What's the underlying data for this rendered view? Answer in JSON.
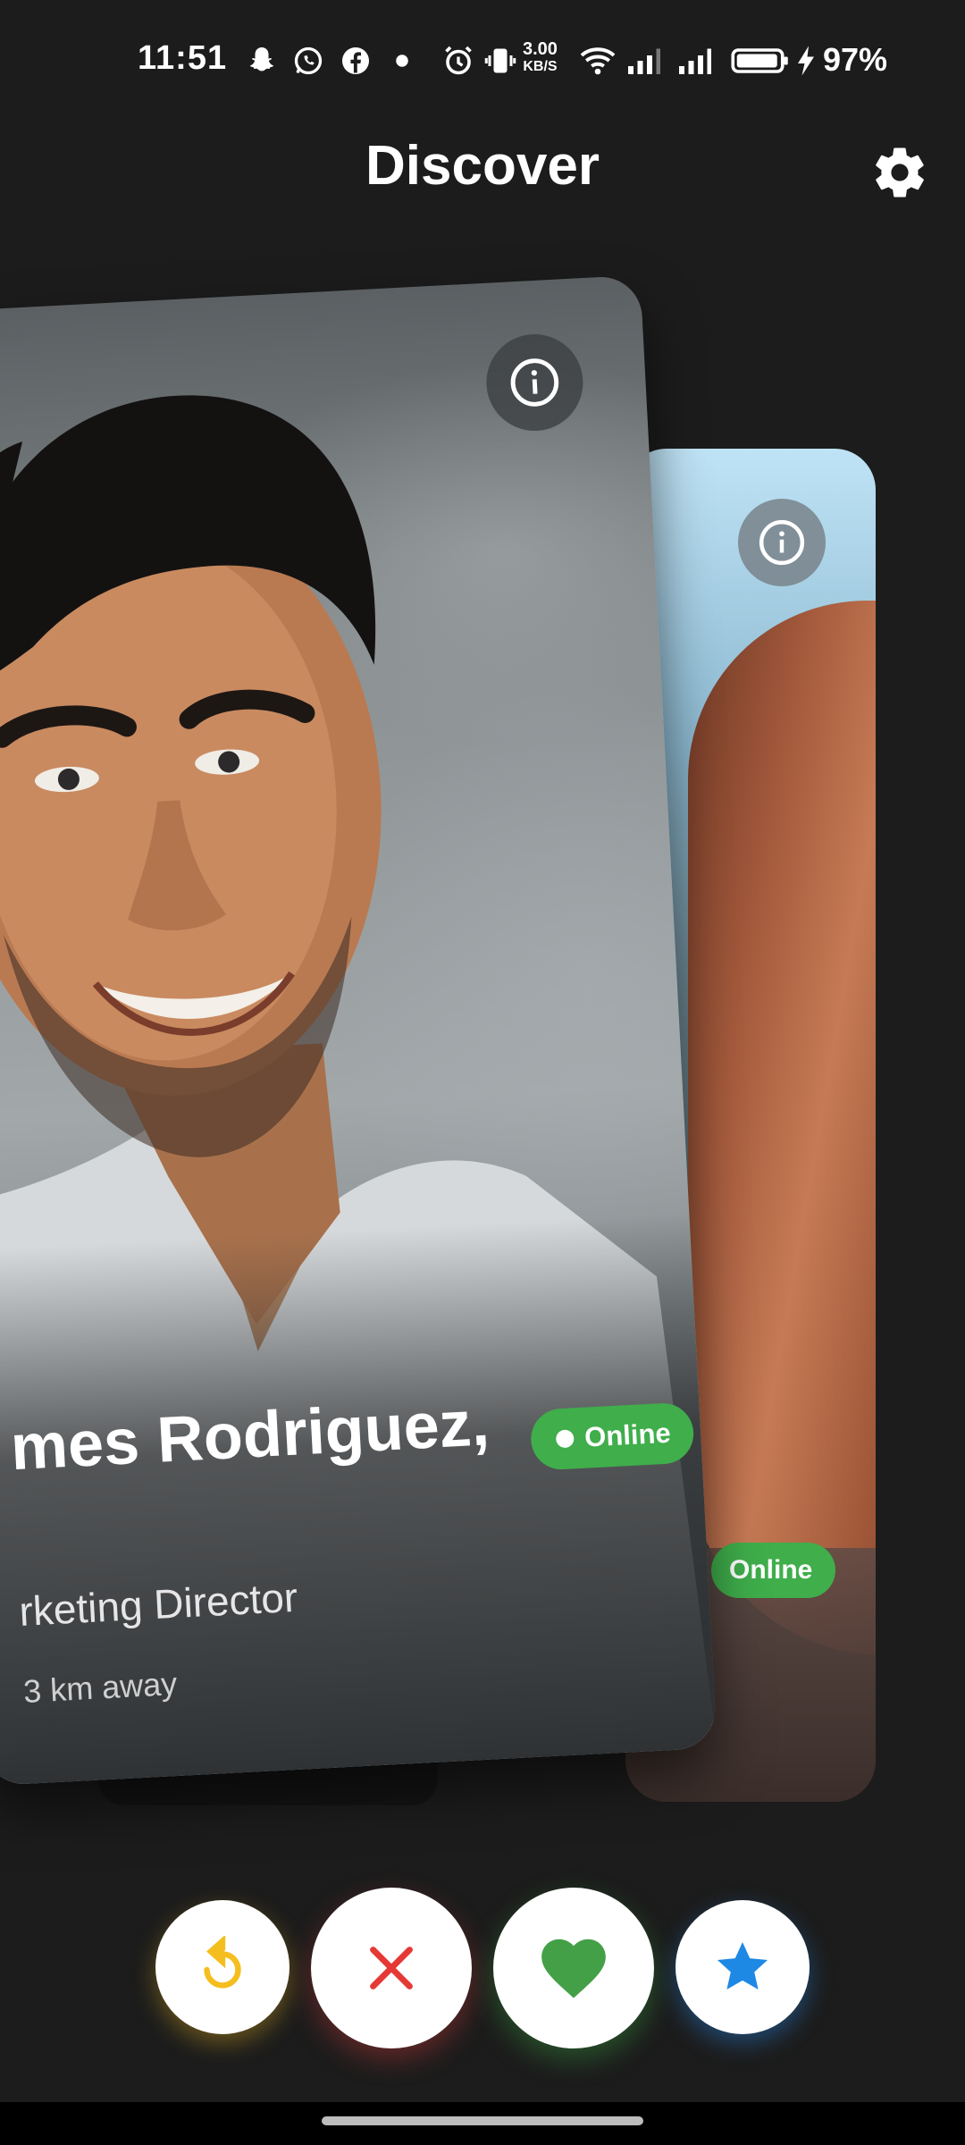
{
  "status_bar": {
    "time": "11:51",
    "speed_value": "3.00",
    "speed_unit": "KB/S",
    "battery": "97%",
    "icons": [
      "snapchat-icon",
      "whatsapp-icon",
      "facebook-icon",
      "dot-icon",
      "alarm-icon",
      "vibrate-icon",
      "wifi-icon",
      "signal-icon",
      "signal-icon",
      "battery-icon",
      "charging-icon"
    ]
  },
  "header": {
    "title": "Discover",
    "settings_icon": "gear-icon"
  },
  "front_card": {
    "name": "mes Rodriguez,",
    "age": "",
    "job": "rketing Director",
    "distance": "3 km away",
    "online_label": "Online",
    "info_icon": "info-icon"
  },
  "back_card": {
    "online_label": "Online",
    "info_icon": "info-icon"
  },
  "actions": {
    "undo_icon": "undo-icon",
    "nope_icon": "close-icon",
    "like_icon": "heart-icon",
    "super_like_icon": "star-icon"
  },
  "colors": {
    "background": "#1c1c1c",
    "online_green": "#3fae4b",
    "undo_yellow": "#f4be1e",
    "nope_red": "#e53935",
    "like_green": "#4caf50",
    "super_blue": "#2196f3"
  }
}
